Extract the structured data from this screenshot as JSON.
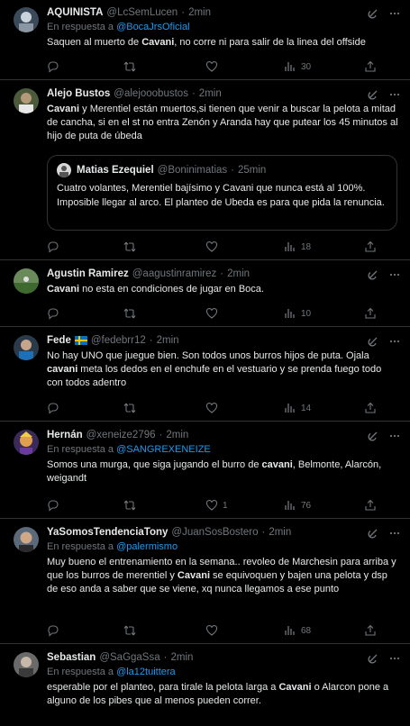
{
  "tweets": [
    {
      "name": "AQUINISTA",
      "handle": "@LcSemLucen",
      "time": "2min",
      "reply_prefix": "En respuesta a",
      "reply_to": "@BocaJrsOficial",
      "text_parts": [
        "Saquen al muerto de ",
        "Cavani",
        ", no corre ni para salir de la linea del offside"
      ],
      "stats": {
        "replies": "",
        "retweets": "",
        "likes": "",
        "views": "30"
      }
    },
    {
      "name": "Alejo Bustos",
      "handle": "@alejooobustos",
      "time": "2min",
      "text_parts": [
        "Cavani",
        " y Merentiel están muertos,si tienen que venir a buscar la pelota a mitad de cancha, si en el st no entra Zenón y Aranda hay que putear los 45 minutos al hijo de puta de úbeda"
      ],
      "quote": {
        "name": "Matias Ezequiel",
        "handle": "@Boninimatias",
        "time": "25min",
        "text": "Cuatro volantes, Merentiel bajísimo y Cavani que nunca está al 100%. Imposible llegar al arco. El planteo de Ubeda es para que pida la renuncia."
      },
      "stats": {
        "replies": "",
        "retweets": "",
        "likes": "",
        "views": "18"
      }
    },
    {
      "name": "Agustin Ramirez",
      "handle": "@aagustinramirez",
      "time": "2min",
      "text_parts": [
        "Cavani",
        " no esta en condiciones de jugar en Boca."
      ],
      "stats": {
        "replies": "",
        "retweets": "",
        "likes": "",
        "views": "10"
      }
    },
    {
      "name": "Fede",
      "handle": "@fedebrr12",
      "time": "2min",
      "text_parts": [
        "No hay UNO que juegue bien. Son todos unos burros hijos de puta. Ojala ",
        "cavani",
        " meta los dedos en el enchufe en el vestuario y se prenda fuego todo con todos adentro"
      ],
      "stats": {
        "replies": "",
        "retweets": "",
        "likes": "",
        "views": "14"
      }
    },
    {
      "name": "Hernán",
      "handle": "@xeneize2796",
      "time": "2min",
      "reply_prefix": "En respuesta a",
      "reply_to": "@SANGREXENEIZE",
      "text_parts": [
        "Somos una murga, que siga jugando el burro de ",
        "cavani",
        ", Belmonte, Alarcón, weigandt"
      ],
      "stats": {
        "replies": "",
        "retweets": "",
        "likes": "1",
        "views": "76"
      }
    },
    {
      "name": "YaSomosTendenciaTony",
      "handle": "@JuanSosBostero",
      "time": "2min",
      "reply_prefix": "En respuesta a",
      "reply_to": "@palermismo",
      "text_parts": [
        "Muy bueno el entrenamiento en la semana.. revoleo de Marchesin para arriba y que los burros de merentiel y ",
        "Cavani",
        " se equivoquen y bajen una pelota y dsp de eso anda a saber que se viene, xq nunca llegamos a ese punto"
      ],
      "stats": {
        "replies": "",
        "retweets": "",
        "likes": "",
        "views": "68"
      }
    },
    {
      "name": "Sebastian",
      "handle": "@SaGgaSsa",
      "time": "2min",
      "reply_prefix": "En respuesta a",
      "reply_to": "@la12tuittera",
      "text_parts": [
        "esperable por el planteo, para tirale la pelota larga a ",
        "Cavani",
        " o Alarcon pone a alguno de los pibes que al menos pueden correr."
      ]
    }
  ],
  "colors": {
    "background": "#000000",
    "text": "#e7e9ea",
    "muted": "#71767b",
    "link": "#1d9bf0",
    "border": "#2f3336"
  },
  "icons": [
    "reply-icon",
    "retweet-icon",
    "like-icon",
    "views-icon",
    "share-icon",
    "grok-icon",
    "more-icon"
  ]
}
